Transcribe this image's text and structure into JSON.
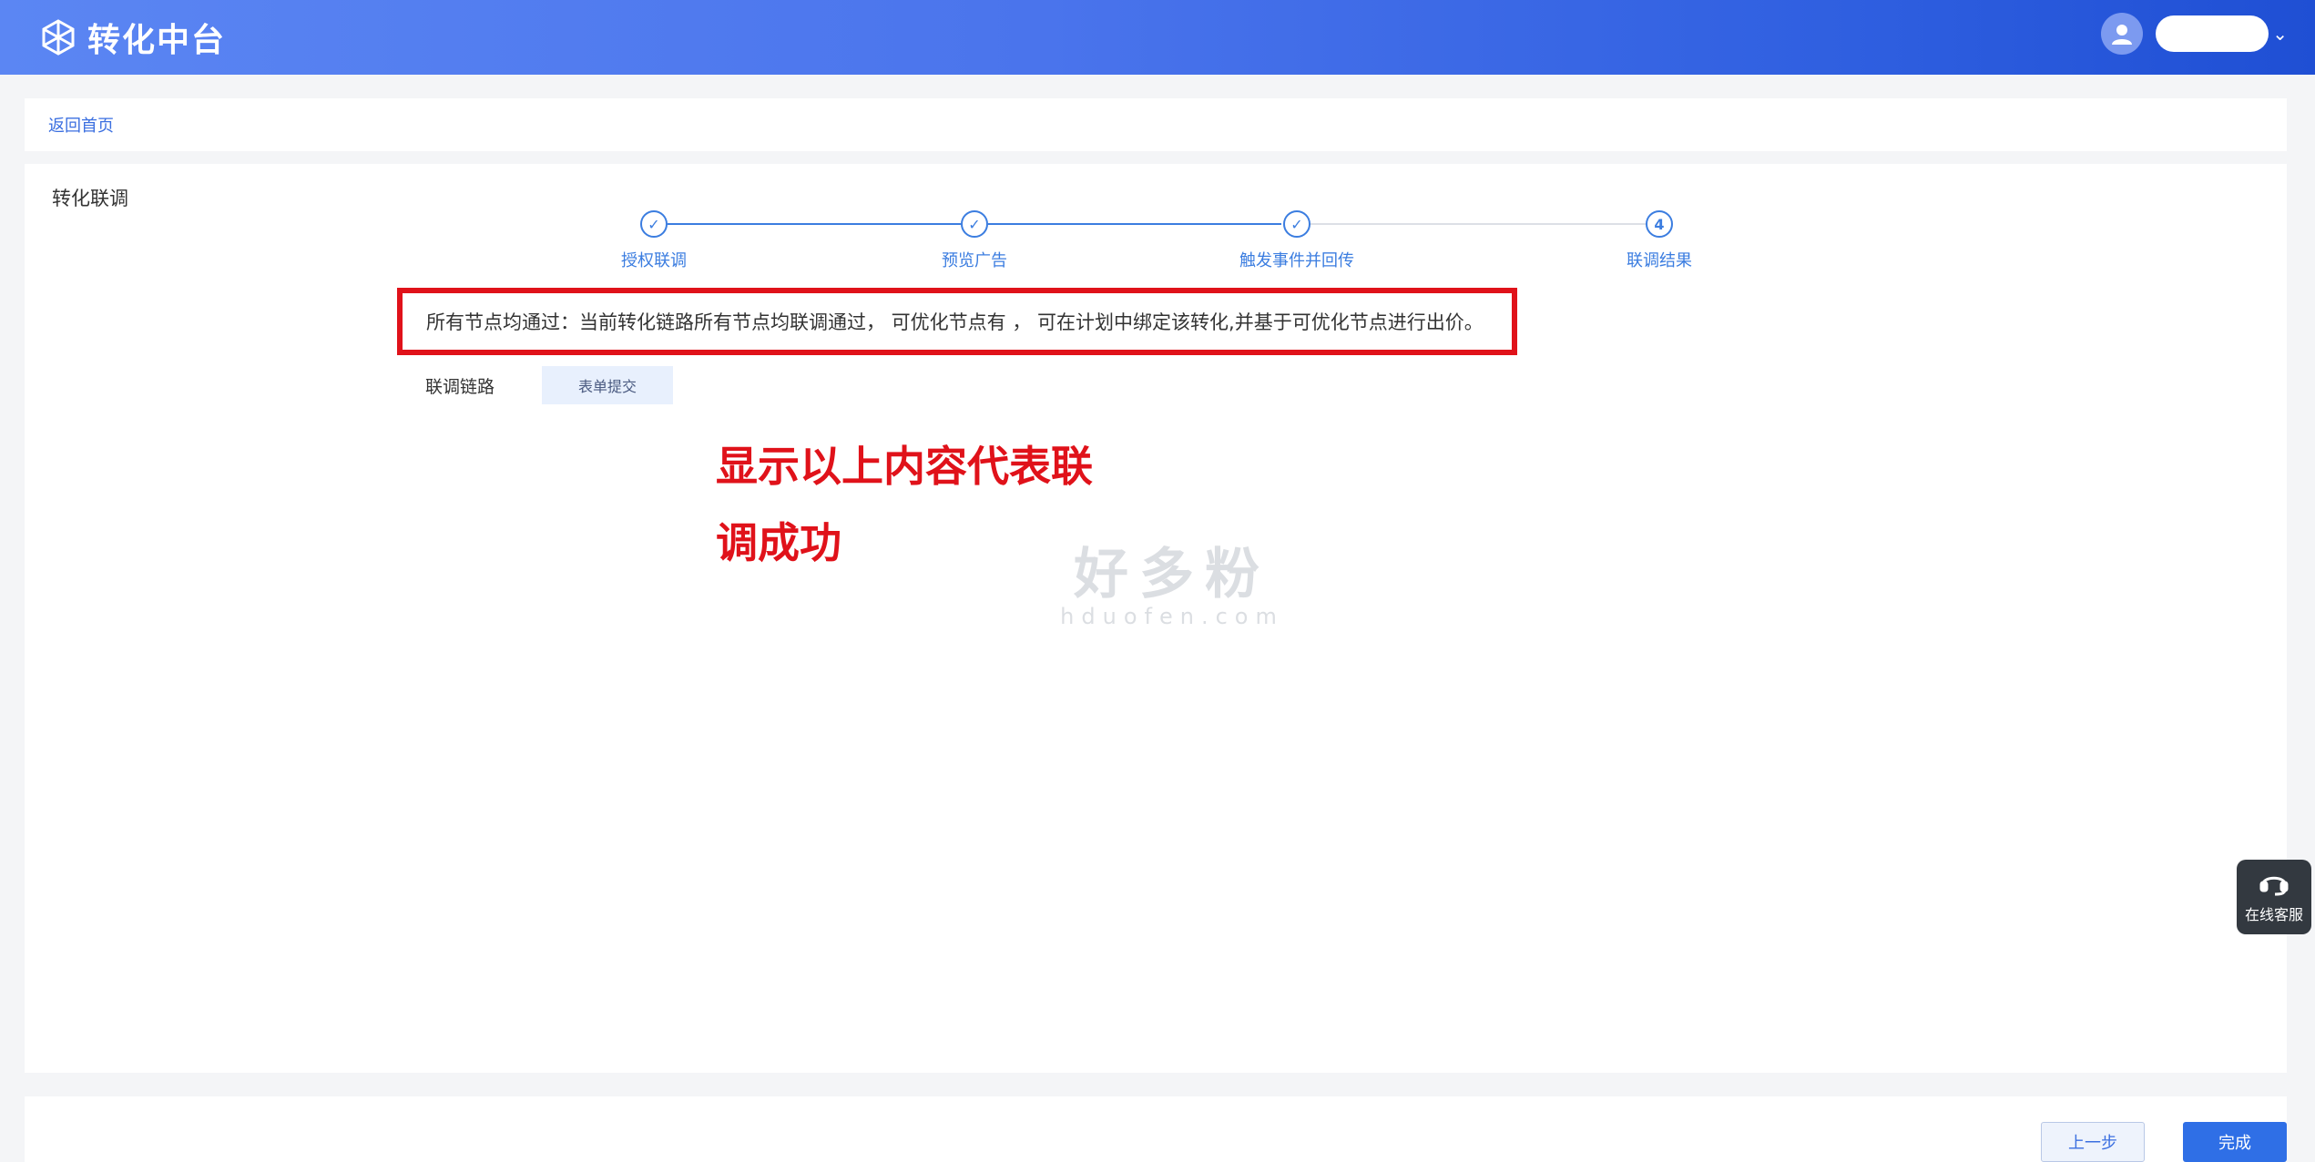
{
  "header": {
    "app_title": "转化中台",
    "brand_color": "#3b6ae6"
  },
  "breadcrumb": {
    "back_label": "返回首页"
  },
  "main": {
    "section_title": "转化联调",
    "steps": [
      {
        "label": "授权联调",
        "status": "done",
        "icon": "check-icon"
      },
      {
        "label": "预览广告",
        "status": "done",
        "icon": "check-icon"
      },
      {
        "label": "触发事件并回传",
        "status": "done",
        "icon": "check-icon"
      },
      {
        "label": "联调结果",
        "status": "current",
        "number": "4"
      }
    ],
    "notice": "所有节点均通过：当前转化链路所有节点均联调通过， 可优化节点有 ， 可在计划中绑定该转化,并基于可优化节点进行出价。",
    "chain_label": "联调链路",
    "chain_tag": "表单提交",
    "annotation_line1": "显示以上内容代表联",
    "annotation_line2": "调成功"
  },
  "watermark": {
    "cn": "好多粉",
    "en": "hduofen.com"
  },
  "service": {
    "label": "在线客服"
  },
  "footer": {
    "prev_label": "上一步",
    "done_label": "完成"
  },
  "colors": {
    "accent": "#3b7de0",
    "highlight_red": "#e0121a"
  }
}
